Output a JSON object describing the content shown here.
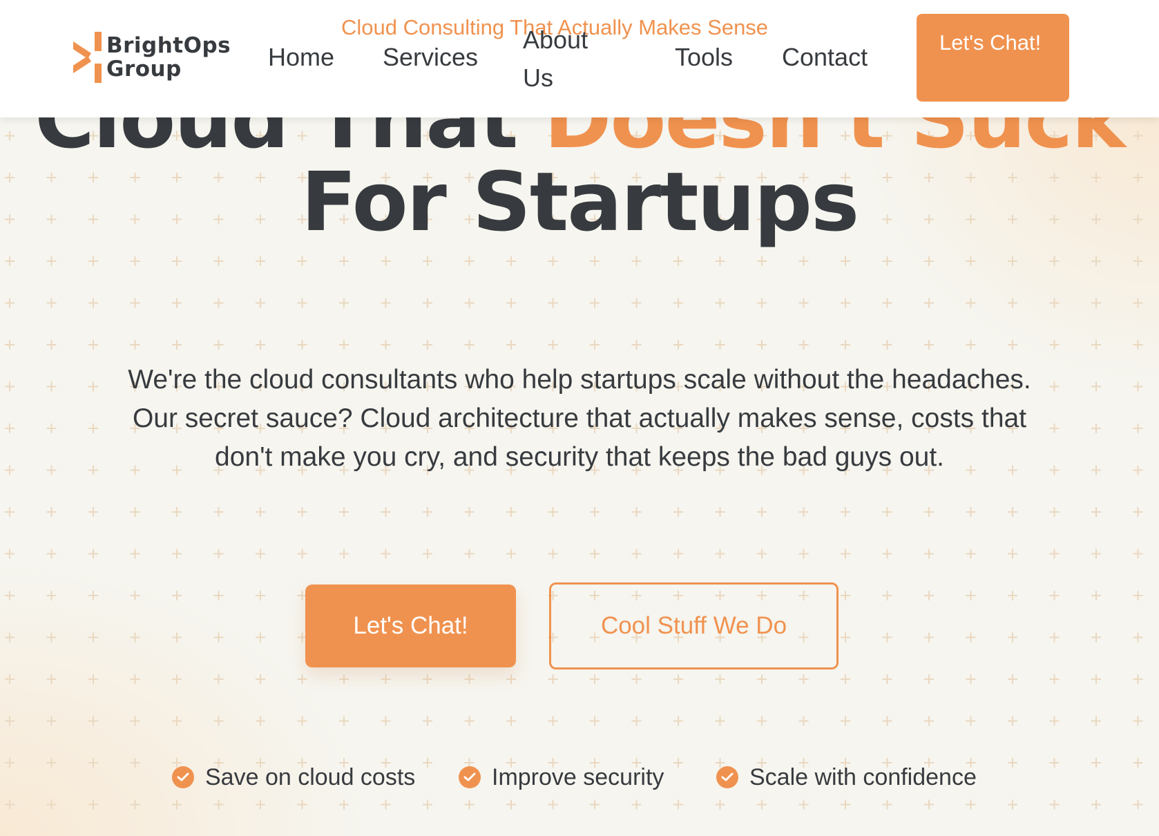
{
  "brand": {
    "name_line1": "BrightOps",
    "name_line2": "Group",
    "tagline": "Cloud Consulting That Actually Makes Sense",
    "accent_color": "#f0924f",
    "text_color": "#373b3f"
  },
  "nav": {
    "home": "Home",
    "services": "Services",
    "about": "About Us",
    "tools": "Tools",
    "contact": "Contact",
    "cta": "Let's Chat!"
  },
  "hero": {
    "title_part1": "Cloud That ",
    "title_accent": "Doesn't Suck",
    "title_part2": "For Startups",
    "subtitle": "We're the cloud consultants who help startups scale without the headaches. Our secret sauce? Cloud architecture that actually makes sense, costs that don't make you cry, and security that keeps the bad guys out.",
    "primary_button": "Let's Chat!",
    "secondary_button": "Cool Stuff We Do"
  },
  "features": [
    {
      "label": "Save on cloud costs",
      "icon": "check-circle-icon"
    },
    {
      "label": "Improve security",
      "icon": "check-circle-icon"
    },
    {
      "label": "Scale with confidence",
      "icon": "check-circle-icon"
    }
  ]
}
